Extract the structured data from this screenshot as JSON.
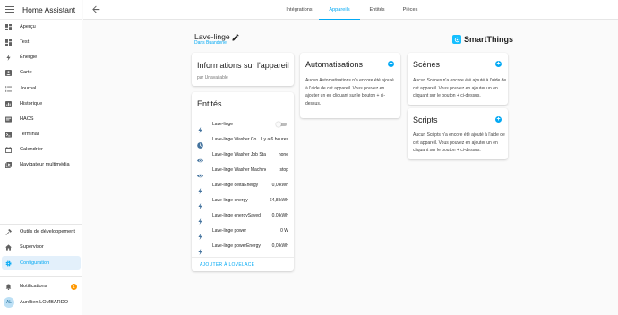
{
  "app": {
    "title": "Home Assistant"
  },
  "sidebar": {
    "items": [
      {
        "label": "Aperçu",
        "icon": "dashboard-icon"
      },
      {
        "label": "Test",
        "icon": "dashboard-icon"
      },
      {
        "label": "Énergie",
        "icon": "lightning-icon"
      },
      {
        "label": "Carte",
        "icon": "account-box-icon"
      },
      {
        "label": "Journal",
        "icon": "list-icon"
      },
      {
        "label": "Historique",
        "icon": "chart-icon"
      },
      {
        "label": "HACS",
        "icon": "hacs-icon"
      },
      {
        "label": "Terminal",
        "icon": "terminal-icon"
      },
      {
        "label": "Calendrier",
        "icon": "calendar-icon"
      },
      {
        "label": "Navigateur multimédia",
        "icon": "media-icon"
      }
    ],
    "bottom_items": [
      {
        "label": "Outils de développement",
        "icon": "hammer-icon"
      },
      {
        "label": "Supervisor",
        "icon": "home-icon"
      },
      {
        "label": "Configuration",
        "icon": "gear-icon"
      }
    ],
    "notifications": {
      "label": "Notifications",
      "count": "1"
    },
    "user": {
      "initials": "AL",
      "name": "Aurélien LOMBARDO"
    }
  },
  "tabs": [
    "Intégrations",
    "Appareils",
    "Entités",
    "Pièces"
  ],
  "active_tab": "Appareils",
  "device": {
    "name": "Lave-linge",
    "area": "Dans Buanderie",
    "brand": "SmartThings"
  },
  "info_card": {
    "title": "Informations sur l'appareil",
    "subtitle": "par Unavailable"
  },
  "entities_card": {
    "title": "Entités",
    "rows": [
      {
        "name": "Lave-linge",
        "value": "",
        "icon": "lightning-icon",
        "toggle": true
      },
      {
        "name": "Lave-linge Washer Co...",
        "value": "Il y a 6 heures",
        "icon": "clock-icon"
      },
      {
        "name": "Lave-linge Washer Job State",
        "value": "none",
        "icon": "eye-icon"
      },
      {
        "name": "Lave-linge Washer Machine St...",
        "value": "stop",
        "icon": "eye-icon"
      },
      {
        "name": "Lave-linge deltaEnergy",
        "value": "0,0 kWh",
        "icon": "lightning-icon"
      },
      {
        "name": "Lave-linge energy",
        "value": "64,8 kWh",
        "icon": "lightning-icon"
      },
      {
        "name": "Lave-linge energySaved",
        "value": "0,0 kWh",
        "icon": "lightning-icon"
      },
      {
        "name": "Lave-linge power",
        "value": "0 W",
        "icon": "lightning-icon"
      },
      {
        "name": "Lave-linge powerEnergy",
        "value": "0,0 kWh",
        "icon": "lightning-icon"
      }
    ],
    "action": "AJOUTER À LOVELACE"
  },
  "automations_card": {
    "title": "Automatisations",
    "lines": [
      "Aucun Automatisations n'a encore été ajouté",
      "à l'aide de cet appareil. Vous pouvez en",
      "ajouter un en cliquant sur le bouton + ci-",
      "dessus."
    ]
  },
  "scenes_card": {
    "title": "Scènes",
    "lines": [
      "Aucun Scènes n'a encore été ajouté à l'aide de",
      "cet appareil. Vous pouvez en ajouter un en",
      "cliquant sur le bouton + ci-dessus."
    ]
  },
  "scripts_card": {
    "title": "Scripts",
    "lines": [
      "Aucun Scripts n'a encore été ajouté à l'aide de",
      "cet appareil. Vous pouvez en ajouter un en",
      "cliquant sur le bouton + ci-dessus."
    ]
  },
  "colors": {
    "accent": "#03a9f4",
    "icon": "#44739e",
    "badge": "#ff9800"
  }
}
